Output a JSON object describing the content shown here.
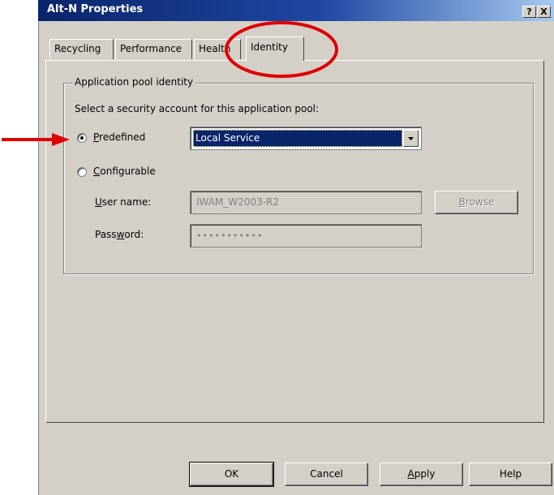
{
  "window": {
    "title": "Alt-N Properties",
    "help_label": "?",
    "close_label": "X"
  },
  "tabs": [
    {
      "label": "Recycling"
    },
    {
      "label": "Performance"
    },
    {
      "label": "Health"
    },
    {
      "label": "Identity",
      "active": true
    }
  ],
  "identity": {
    "group_label": "Application pool identity",
    "instruction": "Select a security account for this application pool:",
    "predefined": {
      "label": "Predefined",
      "selected": true,
      "dropdown_value": "Local Service"
    },
    "configurable": {
      "label": "Configurable",
      "selected": false
    },
    "user_name": {
      "label": "User name:",
      "value": "IWAM_W2003-R2"
    },
    "password": {
      "label": "Password:",
      "value": "•••••••••••"
    },
    "browse_label": "Browse"
  },
  "footer": {
    "ok": "OK",
    "cancel": "Cancel",
    "apply": "Apply",
    "help": "Help"
  },
  "annotations": {
    "color": "#e00000",
    "arrow_target": "predefined-radio",
    "circle_target": "tab-identity"
  }
}
